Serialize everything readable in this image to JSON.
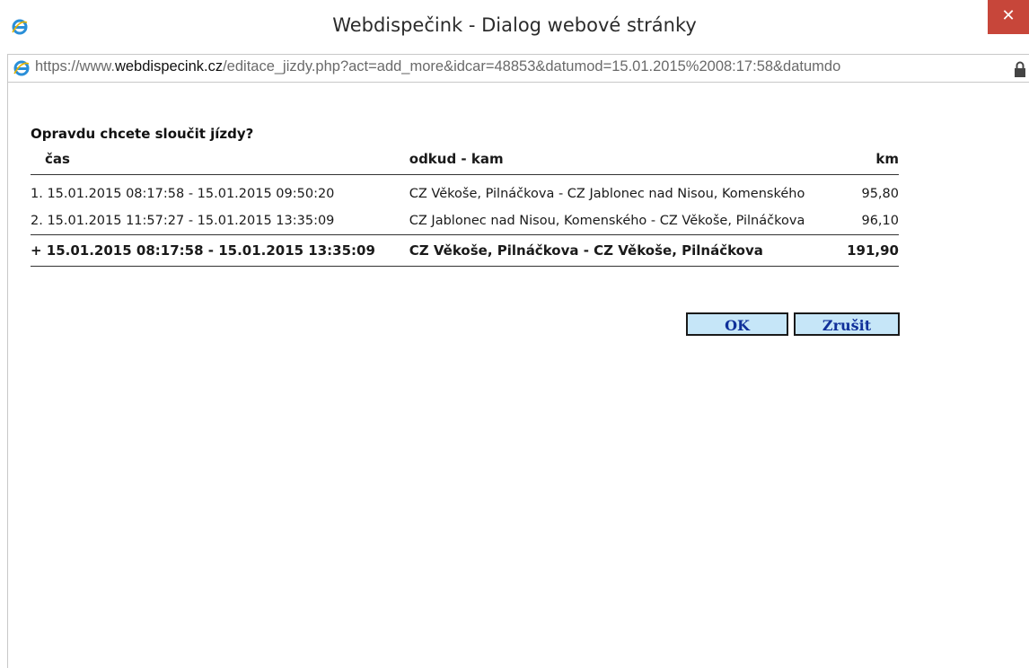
{
  "window": {
    "title": "Webdispečink - Dialog webové stránky",
    "close_glyph": "✕",
    "icon": "ie-logo-icon"
  },
  "address": {
    "scheme": "https://www.",
    "host": "webdispecink.cz",
    "path": "/editace_jizdy.php?act=add_more&idcar=48853&datumod=15.01.2015%2008:17:58&datumdo",
    "lock_icon": "lock-icon"
  },
  "dialog": {
    "question": "Opravdu chcete sloučit jízdy?",
    "columns": [
      "čas",
      "odkud - kam",
      "km"
    ],
    "rows": [
      {
        "num": "1.",
        "time": "15.01.2015 08:17:58 - 15.01.2015 09:50:20",
        "route": "CZ Věkoše, Pilnáčkova - CZ Jablonec nad Nisou, Komenského",
        "km": "95,80"
      },
      {
        "num": "2.",
        "time": "15.01.2015 11:57:27 - 15.01.2015 13:35:09",
        "route": "CZ Jablonec nad Nisou, Komenského - CZ Věkoše, Pilnáčkova",
        "km": "96,10"
      }
    ],
    "total": {
      "time": "+ 15.01.2015 08:17:58 - 15.01.2015 13:35:09",
      "route": "CZ Věkoše, Pilnáčkova - CZ Věkoše, Pilnáčkova",
      "km": "191,90"
    },
    "ok_label": "OK",
    "cancel_label": "Zrušit"
  },
  "colors": {
    "close_bg": "#c7463a",
    "button_bg": "#c6e6f8",
    "button_text": "#10309a"
  }
}
